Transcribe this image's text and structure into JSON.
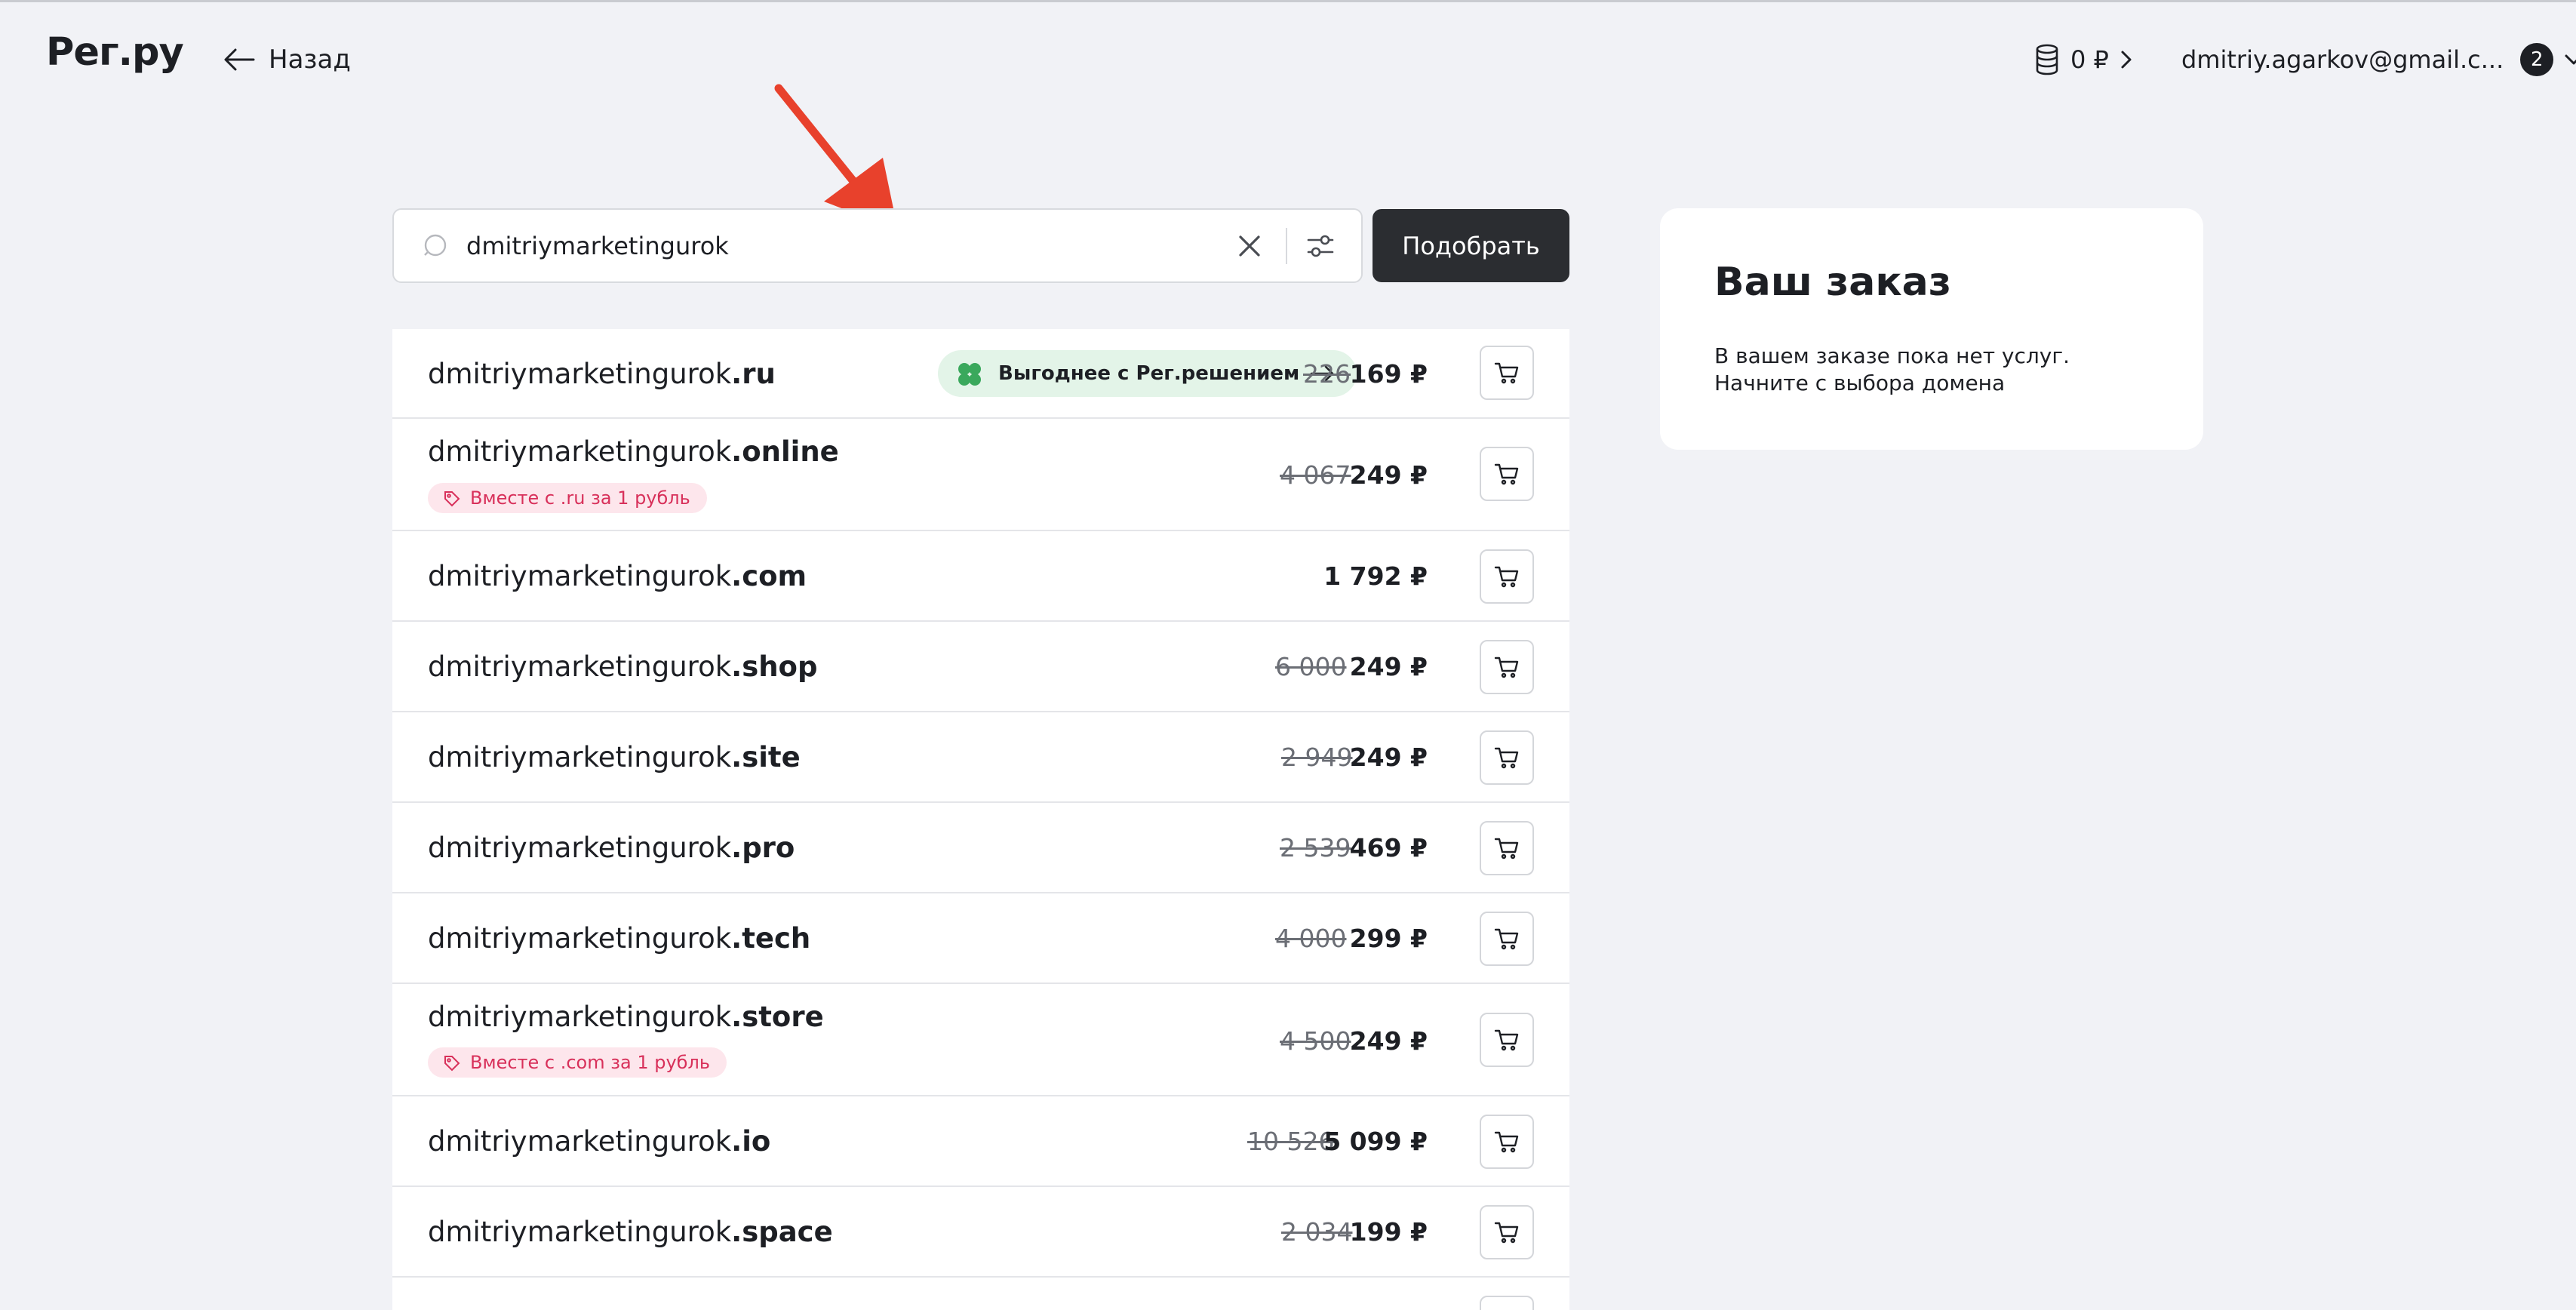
{
  "header": {
    "logo": "Рег.ру",
    "back_label": "Назад",
    "balance": "0 ₽",
    "user_email": "dmitriy.agarkov@gmail.c...",
    "notification_count": "2"
  },
  "search": {
    "value": "dmitriymarketingurok",
    "submit_label": "Подобрать"
  },
  "domains": [
    {
      "name": "dmitriymarketingurok",
      "tld": ".ru",
      "old_price": "226",
      "price": "169 ₽",
      "pill": "Выгоднее с Рег.решением"
    },
    {
      "name": "dmitriymarketingurok",
      "tld": ".online",
      "old_price": "4 067",
      "price": "249 ₽",
      "promo": "Вместе с .ru за 1 рубль"
    },
    {
      "name": "dmitriymarketingurok",
      "tld": ".com",
      "old_price": "",
      "price": "1 792 ₽"
    },
    {
      "name": "dmitriymarketingurok",
      "tld": ".shop",
      "old_price": "6 000",
      "price": "249 ₽"
    },
    {
      "name": "dmitriymarketingurok",
      "tld": ".site",
      "old_price": "2 949",
      "price": "249 ₽"
    },
    {
      "name": "dmitriymarketingurok",
      "tld": ".pro",
      "old_price": "2 539",
      "price": "469 ₽"
    },
    {
      "name": "dmitriymarketingurok",
      "tld": ".tech",
      "old_price": "4 000",
      "price": "299 ₽"
    },
    {
      "name": "dmitriymarketingurok",
      "tld": ".store",
      "old_price": "4 500",
      "price": "249 ₽",
      "promo": "Вместе с .com за 1 рубль"
    },
    {
      "name": "dmitriymarketingurok",
      "tld": ".io",
      "old_price": "10 526",
      "price": "5 099 ₽"
    },
    {
      "name": "dmitriymarketingurok",
      "tld": ".space",
      "old_price": "2 034",
      "price": "199 ₽"
    }
  ],
  "order": {
    "title": "Ваш заказ",
    "empty_text": "В вашем заказе пока нет услуг. Начните с выбора домена"
  },
  "colors": {
    "background": "#f1f2f6",
    "dark_button": "#2b2d31",
    "promo_text": "#d8305a",
    "promo_bg": "#fde6ec",
    "green_pill_bg": "#e3f4e8",
    "annotation_arrow": "#e8412c"
  },
  "icons": [
    "arrow-left-icon",
    "coins-icon",
    "chevron-right-icon",
    "chevron-down-icon",
    "search-icon",
    "close-icon",
    "filter-icon",
    "cart-icon",
    "clover-icon",
    "tag-icon",
    "arrow-right-icon"
  ]
}
